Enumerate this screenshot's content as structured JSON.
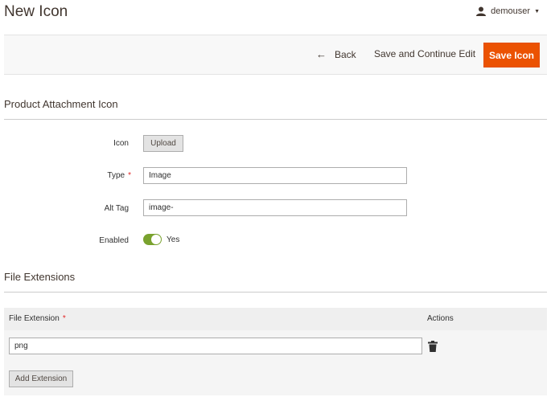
{
  "page": {
    "title": "New Icon"
  },
  "user": {
    "name": "demouser"
  },
  "actions": {
    "back_label": "Back",
    "save_continue_label": "Save and Continue Edit",
    "save_label": "Save Icon"
  },
  "colors": {
    "primary_action": "#eb5202",
    "toggle_on": "#79a22e",
    "required": "#e22626"
  },
  "sections": {
    "attachment": {
      "title": "Product Attachment Icon",
      "icon_label": "Icon",
      "upload_label": "Upload",
      "type_label": "Type",
      "type_value": "Image",
      "alt_label": "Alt Tag",
      "alt_value": "image-",
      "enabled_label": "Enabled",
      "enabled_value": "Yes",
      "enabled": true
    },
    "extensions": {
      "title": "File Extensions",
      "col_extension": "File Extension",
      "col_actions": "Actions",
      "rows": [
        {
          "value": "png"
        }
      ],
      "add_label": "Add Extension"
    }
  },
  "icons": {
    "user": "user-icon",
    "back": "arrow-left-icon",
    "delete": "trash-icon"
  }
}
